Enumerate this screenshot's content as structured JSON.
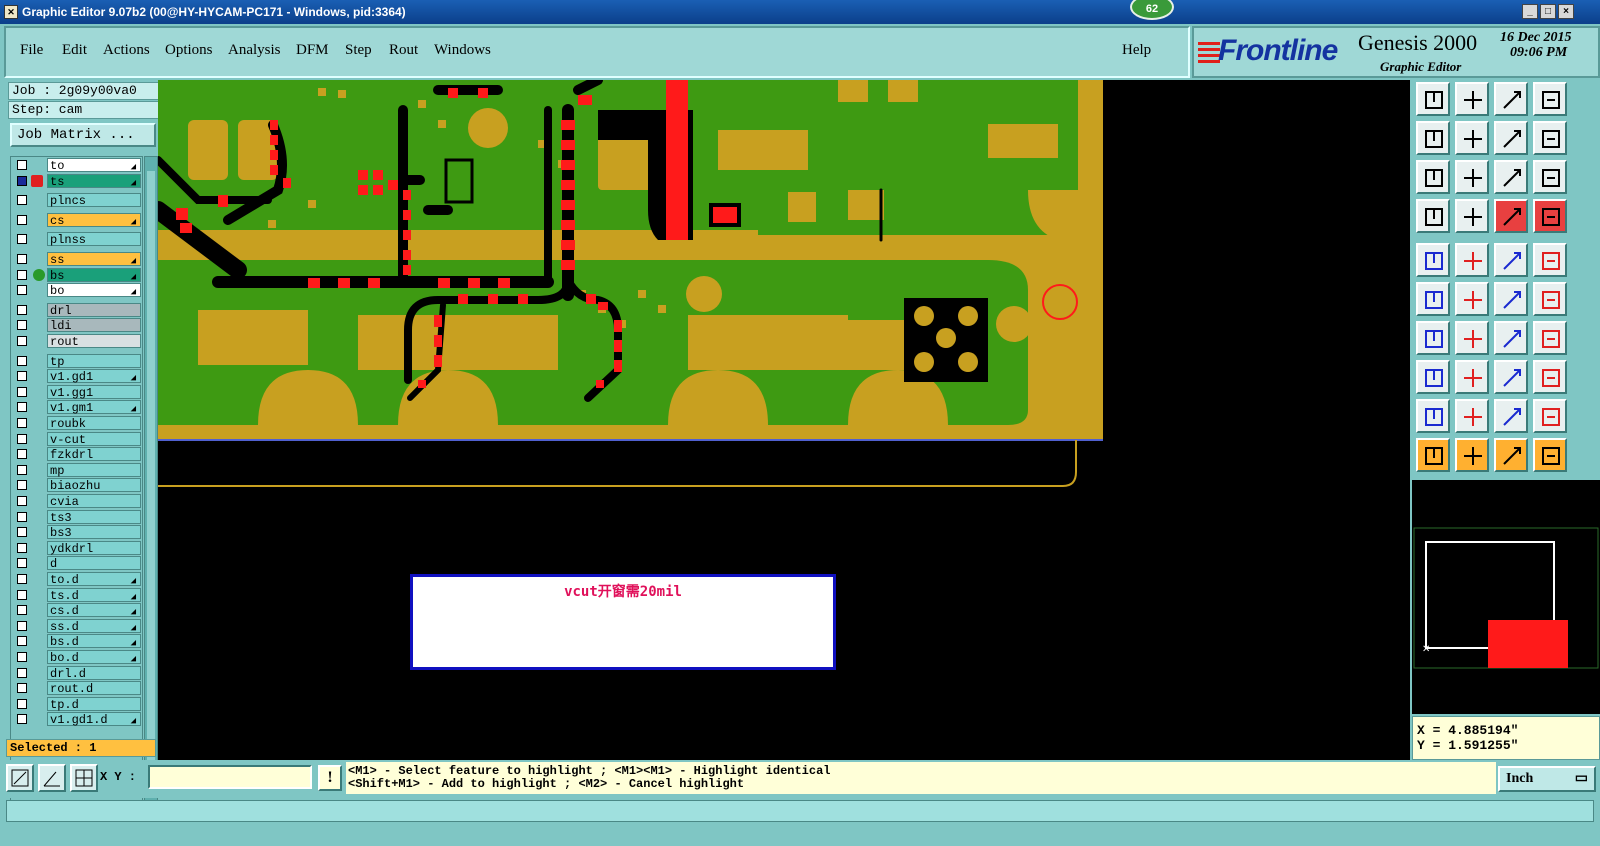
{
  "window": {
    "title": "Graphic Editor 9.07b2 (00@HY-HYCAM-PC171 - Windows, pid:3364)",
    "notification_count": "62",
    "controls": [
      "_",
      "□",
      "×"
    ]
  },
  "menu": {
    "items": [
      "File",
      "Edit",
      "Actions",
      "Options",
      "Analysis",
      "DFM",
      "Step",
      "Rout",
      "Windows"
    ],
    "help": "Help"
  },
  "brand": {
    "logo": "Frontline",
    "product": "Genesis 2000",
    "subtitle": "Graphic Editor",
    "date": "16 Dec 2015",
    "time": "09:06 PM"
  },
  "job": {
    "job_label": "Job : 2g09y00va0",
    "step_label": "Step: cam",
    "matrix_button": "Job Matrix ..."
  },
  "layers": [
    {
      "name": "to",
      "style": "white",
      "pin": true
    },
    {
      "name": "ts",
      "style": "teal",
      "pin": true,
      "active": true
    },
    {
      "name": "plncs",
      "style": "plain"
    },
    {
      "name": "cs",
      "style": "orange",
      "pin": true
    },
    {
      "name": "plnss",
      "style": "plain"
    },
    {
      "name": "ss",
      "style": "orange",
      "pin": true
    },
    {
      "name": "bs",
      "style": "teal",
      "pin": true,
      "displayed": true
    },
    {
      "name": "bo",
      "style": "white",
      "pin": true
    },
    {
      "name": "drl",
      "style": "gray"
    },
    {
      "name": "ldi",
      "style": "gray"
    },
    {
      "name": "rout",
      "style": "lgray"
    },
    {
      "name": "tp",
      "style": "plain"
    },
    {
      "name": "v1.gd1",
      "style": "plain",
      "pin": true
    },
    {
      "name": "v1.gg1",
      "style": "plain"
    },
    {
      "name": "v1.gm1",
      "style": "plain",
      "pin": true
    },
    {
      "name": "roubk",
      "style": "plain"
    },
    {
      "name": "v-cut",
      "style": "plain"
    },
    {
      "name": "fzkdrl",
      "style": "plain"
    },
    {
      "name": "mp",
      "style": "plain"
    },
    {
      "name": "biaozhu",
      "style": "plain"
    },
    {
      "name": "cvia",
      "style": "plain"
    },
    {
      "name": "ts3",
      "style": "plain"
    },
    {
      "name": "bs3",
      "style": "plain"
    },
    {
      "name": "ydkdrl",
      "style": "plain"
    },
    {
      "name": "d",
      "style": "plain"
    },
    {
      "name": "to.d",
      "style": "plain",
      "pin": true
    },
    {
      "name": "ts.d",
      "style": "plain",
      "pin": true
    },
    {
      "name": "cs.d",
      "style": "plain",
      "pin": true
    },
    {
      "name": "ss.d",
      "style": "plain",
      "pin": true
    },
    {
      "name": "bs.d",
      "style": "plain",
      "pin": true
    },
    {
      "name": "bo.d",
      "style": "plain",
      "pin": true
    },
    {
      "name": "drl.d",
      "style": "plain"
    },
    {
      "name": "rout.d",
      "style": "plain"
    },
    {
      "name": "tp.d",
      "style": "plain"
    },
    {
      "name": "v1.gd1.d",
      "style": "plain",
      "pin": true
    }
  ],
  "selected": "Selected : 1",
  "canvas": {
    "annotation": "vcut开窗需20mil"
  },
  "coords": {
    "x": "X = 4.885194\"",
    "y": "Y = 1.591255\""
  },
  "bottom": {
    "xy_label": "X Y :",
    "xy_value": "",
    "alert": "!",
    "help_line1": "<M1> - Select feature to highlight ; <M1><M1> - Highlight identical",
    "help_line2": "<Shift+M1> - Add to highlight ; <M2> - Cancel highlight",
    "units": "Inch"
  },
  "colors": {
    "board_green": "#3e9a12",
    "copper": "#c8a020",
    "trace_red": "#ff1a1a",
    "panel_teal": "#7fc6c4",
    "highlight_orange": "#ffc040"
  }
}
